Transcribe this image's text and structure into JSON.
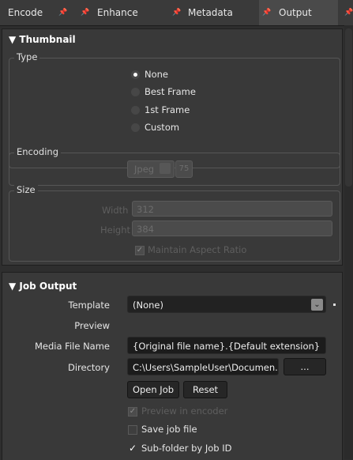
{
  "tabs": [
    {
      "label": "Encode",
      "active": false
    },
    {
      "label": "Enhance",
      "active": false
    },
    {
      "label": "Metadata",
      "active": false
    },
    {
      "label": "Output",
      "active": true
    }
  ],
  "thumbnail": {
    "title": "▼ Thumbnail",
    "type": {
      "label": "Type",
      "options": [
        "None",
        "Best Frame",
        "1st Frame",
        "Custom"
      ],
      "selected": "None"
    },
    "encoding": {
      "label": "Encoding",
      "format": "Jpeg",
      "quality": "75"
    },
    "size": {
      "label": "Size",
      "width_label": "Width",
      "width": "312",
      "height_label": "Height",
      "height": "384",
      "maintain_label": "Maintain Aspect Ratio",
      "maintain_checked": true
    }
  },
  "job_output": {
    "title": "▼ Job Output",
    "template_label": "Template",
    "template_value": "(None)",
    "preview_label": "Preview",
    "media_file_name_label": "Media File Name",
    "media_file_name_value": "{Original file name}.{Default extension}",
    "directory_label": "Directory",
    "directory_value": "C:\\Users\\SampleUser\\Documen...",
    "browse_label": "...",
    "open_job_label": "Open Job",
    "reset_label": "Reset",
    "preview_in_encoder_label": "Preview in encoder",
    "preview_in_encoder_checked": true,
    "save_job_file_label": "Save job file",
    "save_job_file_checked": false,
    "subfolder_label": "Sub-folder by Job ID",
    "subfolder_checked": true
  },
  "colors": {
    "background": "#2e2e2e",
    "panel": "#393939",
    "field": "#1c1c1c",
    "text": "#e6e6e6",
    "disabled_text": "#5e5e5e"
  },
  "icons": [
    "pin-icon",
    "radio-icon",
    "dropdown-arrow-icon",
    "checkbox-icon"
  ]
}
